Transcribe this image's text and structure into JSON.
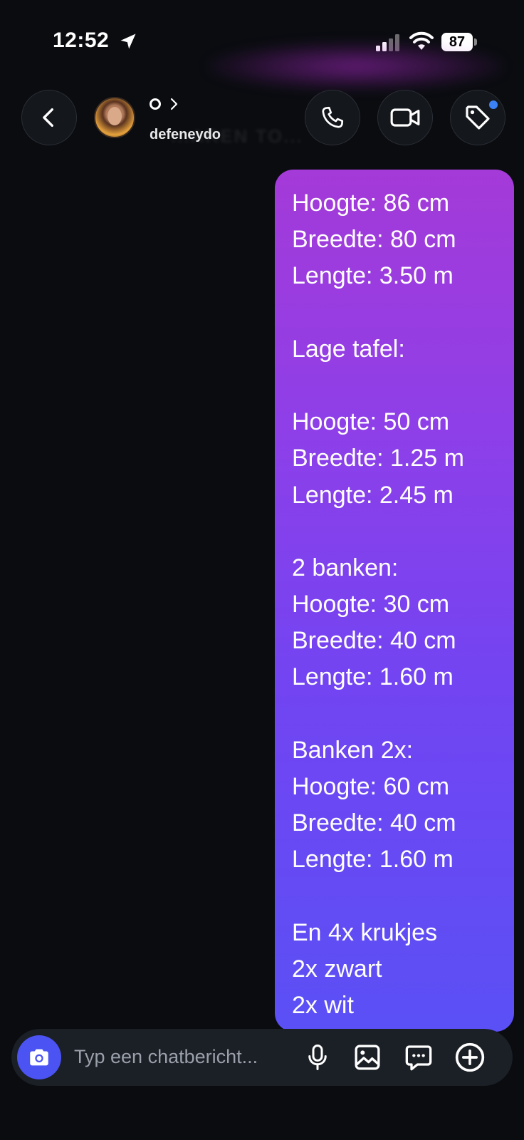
{
  "status_bar": {
    "time": "12:52",
    "battery": "87"
  },
  "header": {
    "username": "defeneydo",
    "ghost_text": "...AREN TO..."
  },
  "message": {
    "lines": [
      "Hoogte: 86 cm",
      "Breedte: 80 cm",
      "Lengte: 3.50 m",
      "",
      "Lage tafel:",
      "",
      "Hoogte: 50 cm",
      "Breedte: 1.25 m",
      "Lengte: 2.45 m",
      "",
      "2 banken:",
      "Hoogte: 30 cm",
      "Breedte: 40 cm",
      "Lengte: 1.60 m",
      "",
      "Banken 2x:",
      "Hoogte: 60 cm",
      "Breedte: 40 cm",
      "Lengte: 1.60 m",
      "",
      "En 4x krukjes",
      "2x zwart",
      "2x wit"
    ]
  },
  "composer": {
    "placeholder": "Typ een chatbericht..."
  },
  "colors": {
    "background": "#0a0c10",
    "bubble_top": "#a43ad8",
    "bubble_bottom": "#5a50f5",
    "camera_button": "#4b53f2",
    "notification_dot": "#3b82f6"
  },
  "icons": [
    "location-arrow-icon",
    "signal-icon",
    "wifi-icon",
    "battery-icon",
    "chevron-left-icon",
    "chevron-right-icon",
    "phone-icon",
    "video-camera-icon",
    "tag-icon",
    "camera-icon",
    "microphone-icon",
    "gallery-icon",
    "sticker-icon",
    "plus-circle-icon"
  ]
}
